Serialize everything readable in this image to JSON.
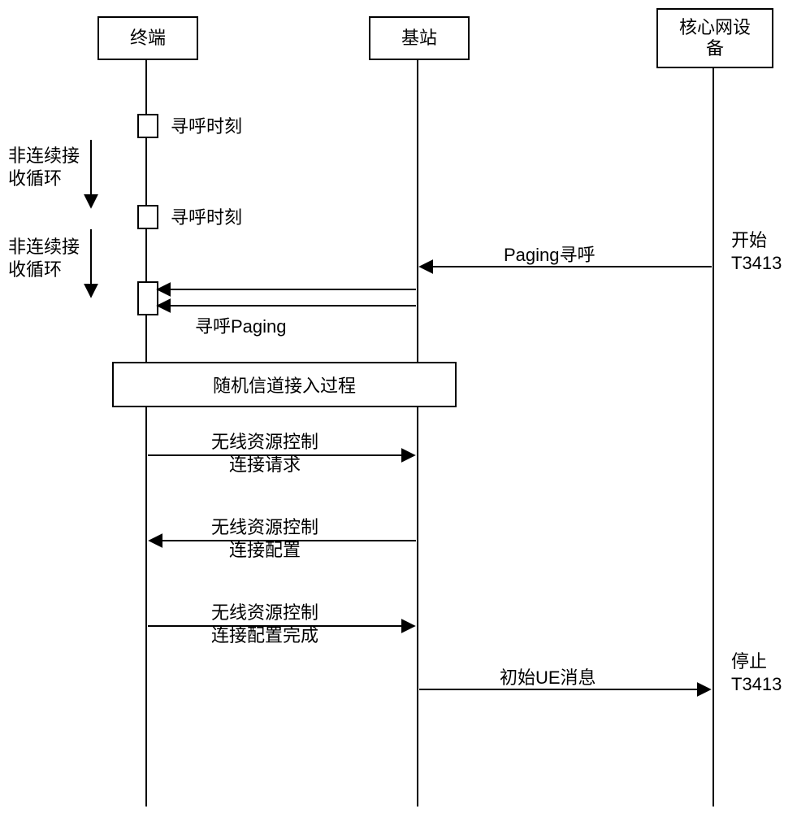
{
  "actors": {
    "terminal": "终端",
    "base_station": "基站",
    "core_network": "核心网设\n备"
  },
  "events": {
    "paging_time_1": "寻呼时刻",
    "paging_time_2": "寻呼时刻",
    "drx_loop_1": "非连续接\n收循环",
    "drx_loop_2": "非连续接\n收循环",
    "paging_from_core": "Paging寻呼",
    "start_t3413": "开始\nT3413",
    "paging_to_terminal": "寻呼Paging",
    "random_access": "随机信道接入过程",
    "rrc_conn_request": "无线资源控制\n连接请求",
    "rrc_conn_config": "无线资源控制\n连接配置",
    "rrc_conn_complete": "无线资源控制\n连接配置完成",
    "initial_ue_msg": "初始UE消息",
    "stop_t3413": "停止\nT3413"
  }
}
